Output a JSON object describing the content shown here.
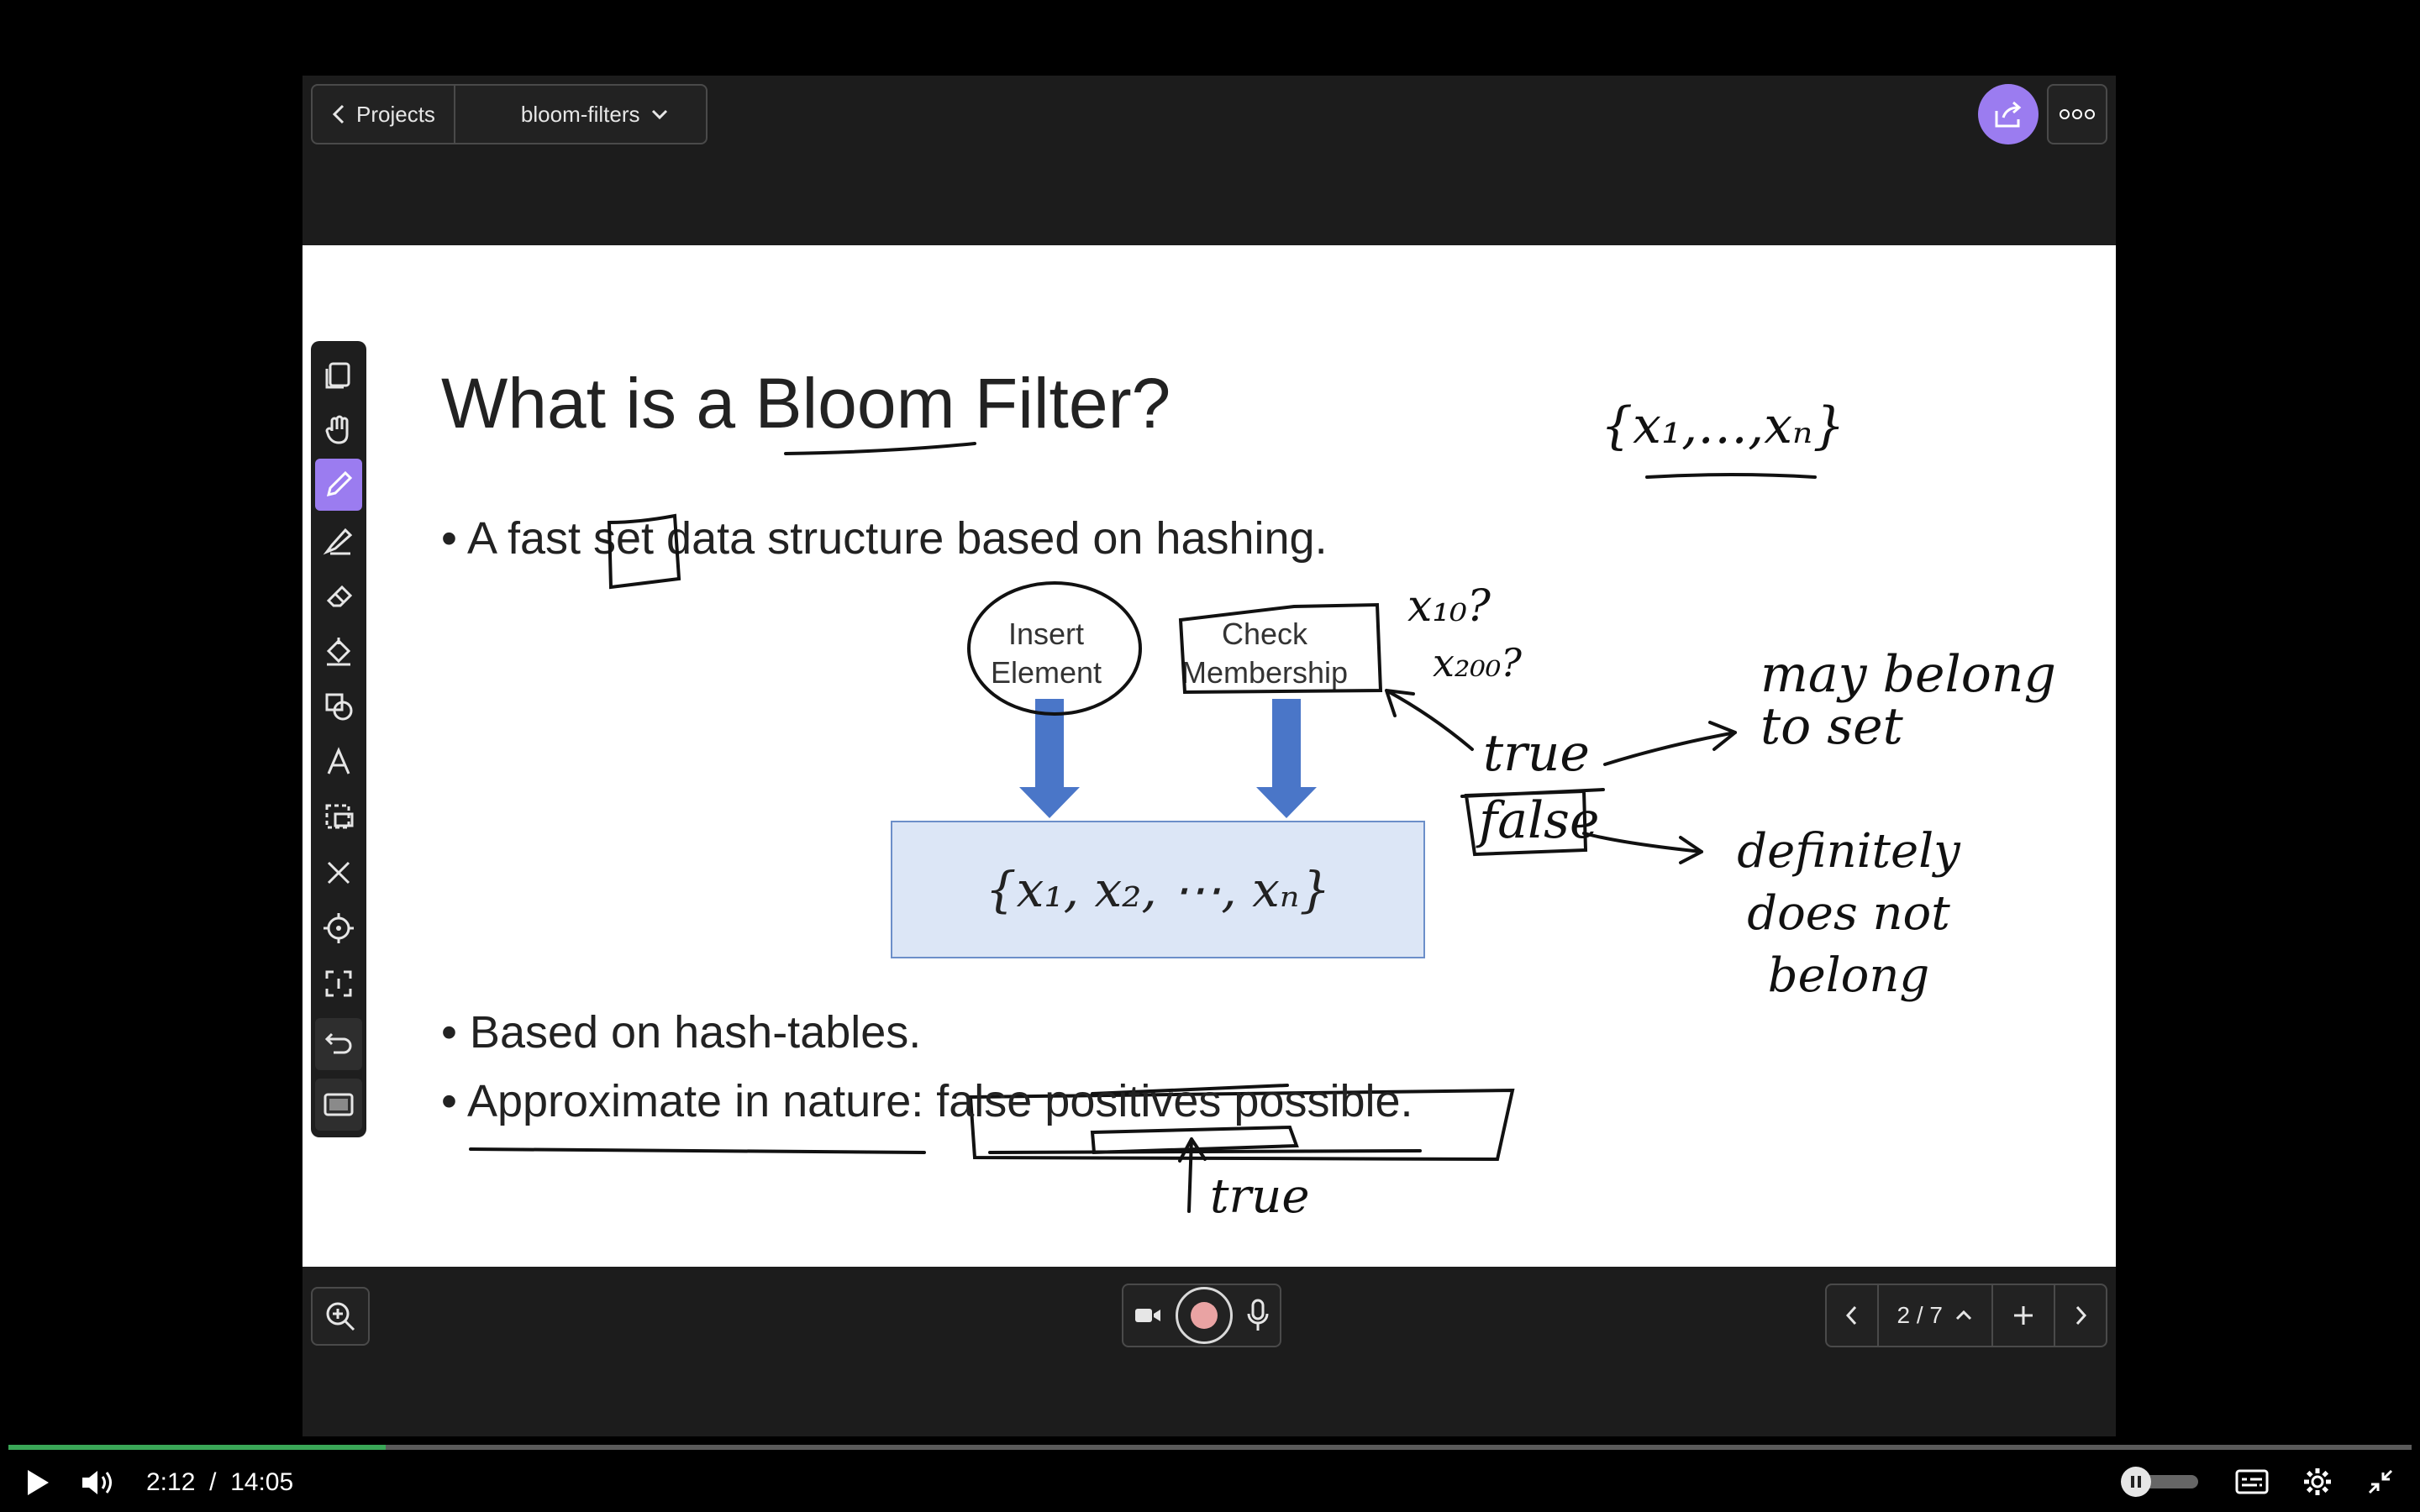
{
  "topbar": {
    "back_label": "Projects",
    "project_name": "bloom-filters"
  },
  "slide": {
    "title": "What is a Bloom Filter?",
    "bullet1": "A fast set data structure based on hashing.",
    "insert_node": "Insert Element",
    "check_node": "Check Membership",
    "set_box": "{x₁, x₂, ⋯, xₙ}",
    "bullet2": "Based on hash-tables.",
    "bullet3": "Approximate in nature: false positives possible."
  },
  "annotations": {
    "set_note": "{x₁,…,xₙ}",
    "query_note_1": "x₁₀?",
    "query_note_2": "x₂₀₀?",
    "true_label": "true",
    "true_result": "may belong to set",
    "false_label": "false",
    "false_result": "definitely does not belong",
    "true_under": "true"
  },
  "pager": {
    "page": "2 / 7"
  },
  "player": {
    "current_time": "2:12",
    "separator": "/",
    "duration": "14:05",
    "progress": 0.157
  },
  "colors": {
    "accent": "#9b7cf0",
    "progress": "#3aa757",
    "diagram_box": "#dce6f6",
    "arrow": "#4a76c8"
  }
}
